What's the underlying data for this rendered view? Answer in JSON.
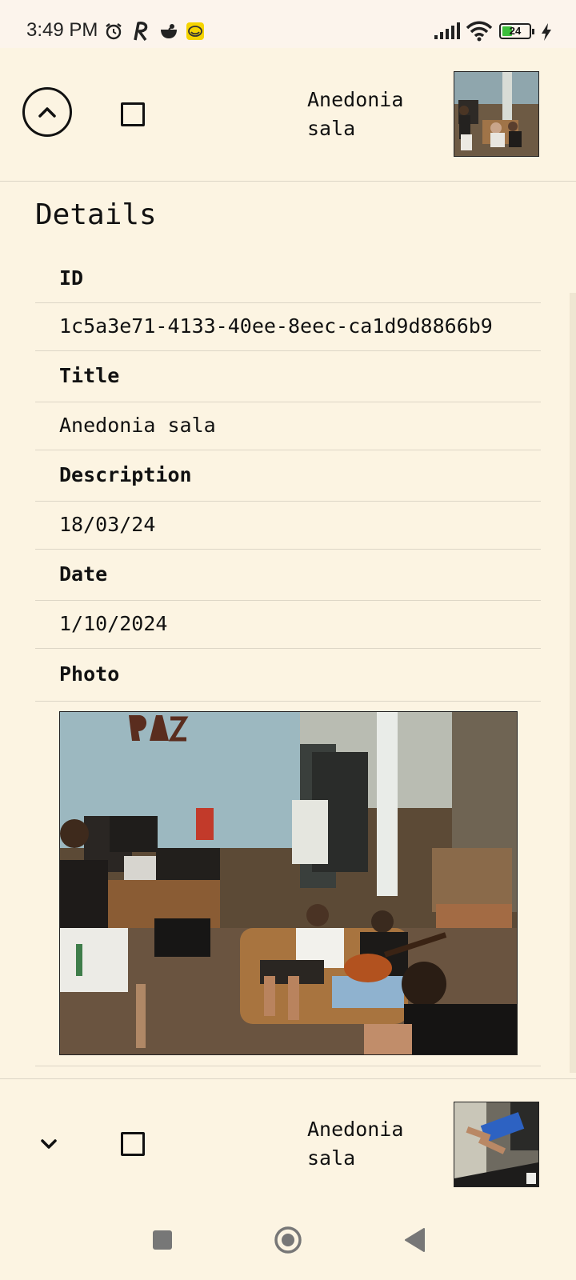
{
  "status_bar": {
    "time": "3:49 PM",
    "battery_level": "24",
    "icons": [
      "alarm-icon",
      "r-app-icon",
      "cup-icon",
      "emoji-app-icon",
      "signal-icon",
      "wifi-icon",
      "battery-icon",
      "charging-icon"
    ]
  },
  "top_item": {
    "title": "Anedonia sala",
    "expand_icon": "chevron-up-icon",
    "checked": false
  },
  "details": {
    "heading": "Details",
    "fields": [
      {
        "label": "ID",
        "value": "1c5a3e71-4133-40ee-8eec-ca1d9d8866b9"
      },
      {
        "label": "Title",
        "value": "Anedonia sala"
      },
      {
        "label": "Description",
        "value": "18/03/24"
      },
      {
        "label": "Date",
        "value": "1/10/2024"
      },
      {
        "label": "Photo"
      }
    ],
    "photo_name": "room-photo"
  },
  "next_item": {
    "title": "Anedonia sala",
    "expand_icon": "chevron-down-icon",
    "checked": false
  },
  "nav": {
    "icons": [
      "recents-square-icon",
      "home-circle-icon",
      "back-triangle-icon"
    ]
  },
  "colors": {
    "background": "#fcf4e2",
    "text": "#111111",
    "divider": "#ddd6c6"
  }
}
